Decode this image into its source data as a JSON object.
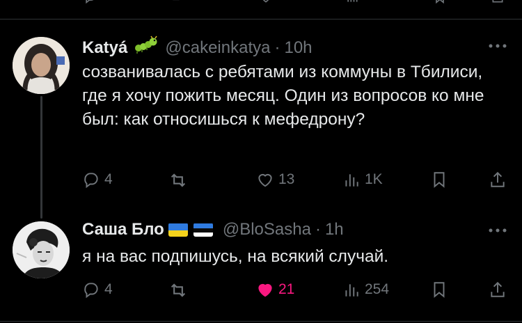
{
  "tweets": [
    {
      "name": "Katyá",
      "handle": "@cakeinkatya",
      "separator": "·",
      "time": "10h",
      "text": "созванивалась с ребятами из коммуны в Тбилиси, где я хочу пожить месяц. Один из вопросов ко мне был: как относишься к мефедрону?",
      "replies": "4",
      "reposts": "",
      "likes": "13",
      "views": "1K",
      "emoji_icon": "caterpillar-icon"
    },
    {
      "name": "Саша Бло",
      "handle": "@BloSasha",
      "separator": "·",
      "time": "1h",
      "text": "я на вас подпишусь, на всякий случай.",
      "replies": "4",
      "reposts": "",
      "likes": "21",
      "views": "254",
      "liked": true,
      "flags": [
        "ukraine-flag-icon",
        "estonia-flag-icon"
      ]
    }
  ],
  "colors": {
    "background": "#000000",
    "text": "#e7e9ea",
    "muted": "#71767b",
    "like_active": "#f91880",
    "separator": "#2f3336"
  }
}
